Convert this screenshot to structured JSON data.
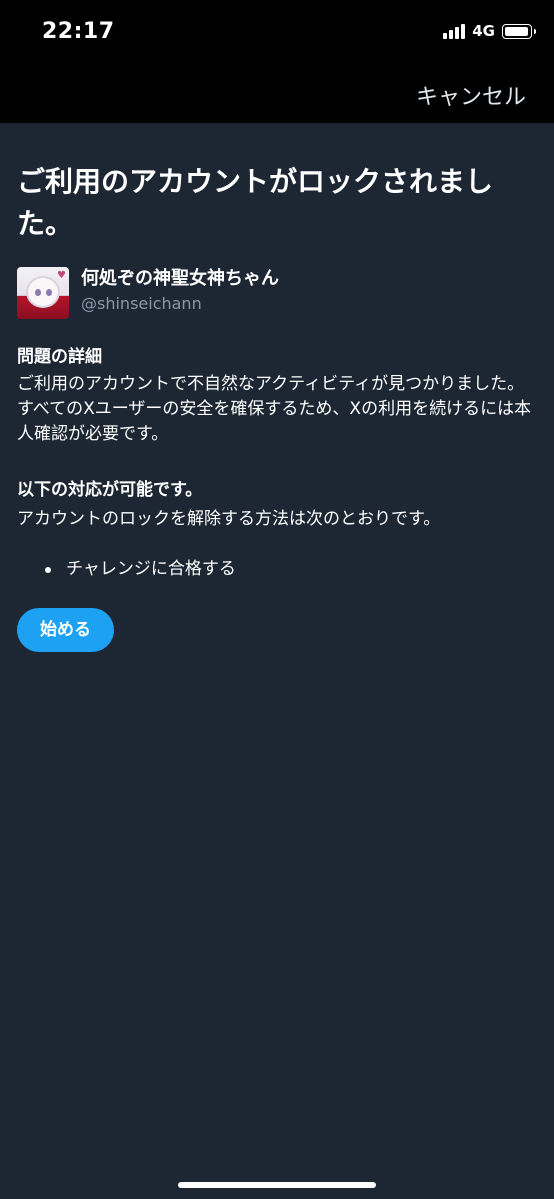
{
  "status_bar": {
    "time": "22:17",
    "network": "4G",
    "signal_bars": 4,
    "battery_level": 0.95,
    "signal_icon": "cellular-signal-icon",
    "battery_icon": "battery-icon"
  },
  "nav": {
    "cancel_label": "キャンセル"
  },
  "main": {
    "title": "ご利用のアカウントがロックされました。",
    "account": {
      "display_name": "何処ぞの神聖女神ちゃん",
      "handle": "@shinseichann",
      "avatar_icon": "anime-avatar"
    },
    "details_heading": "問題の詳細",
    "details_body": "ご利用のアカウントで不自然なアクティビティが見つかりました。すべてのXユーザーの安全を確保するため、Xの利用を続けるには本人確認が必要です。",
    "options_heading": "以下の対応が可能です。",
    "options_body": "アカウントのロックを解除する方法は次のとおりです。",
    "bullets": [
      "チャレンジに合格する"
    ],
    "start_button_label": "始める"
  },
  "colors": {
    "background": "#1c2733",
    "top_bar": "#000000",
    "accent": "#1da1f2",
    "secondary_text": "#8899a6"
  }
}
